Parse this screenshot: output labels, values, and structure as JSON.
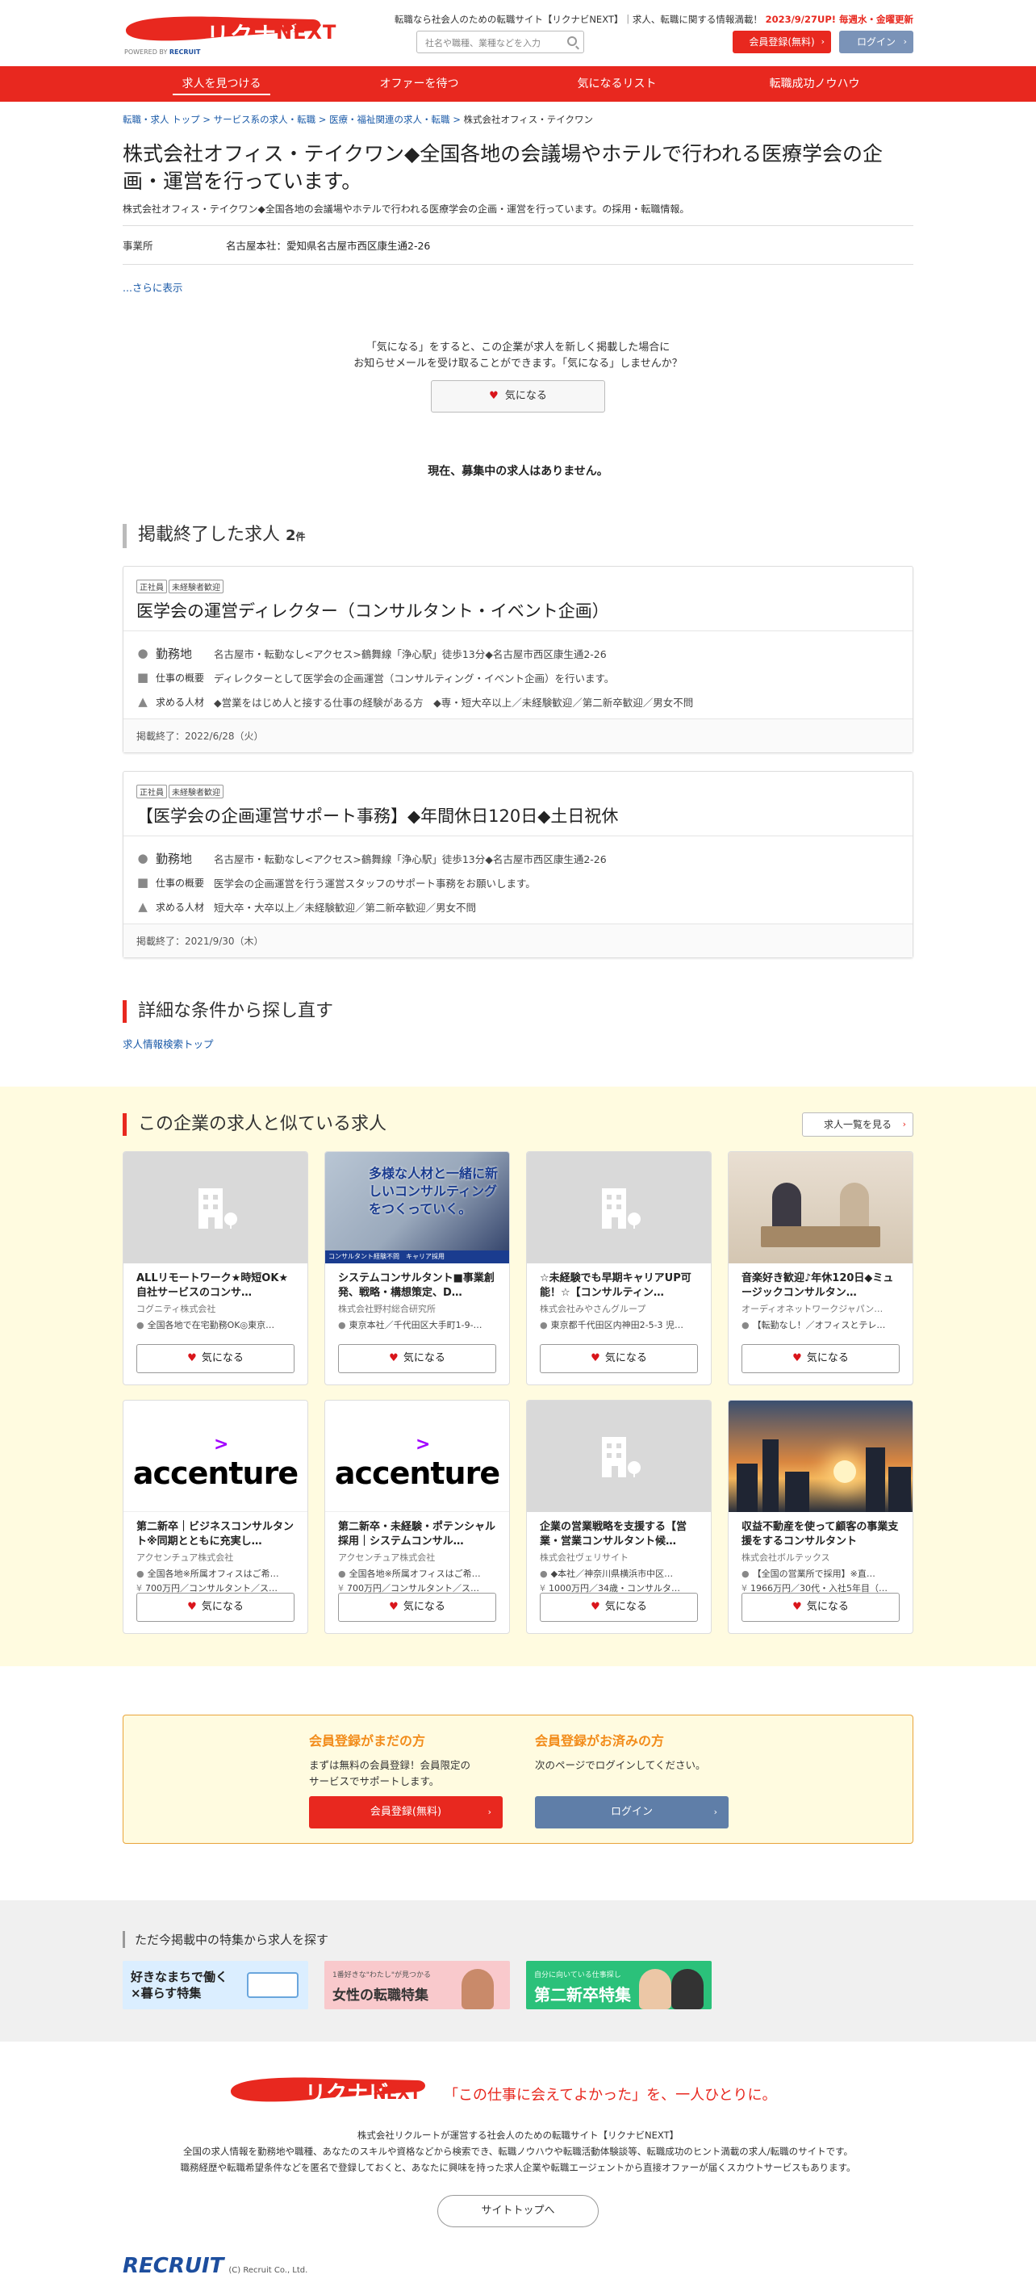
{
  "header": {
    "logo_text": "リクナビ",
    "logo_next": "NEXT",
    "powered_by": "POWERED BY",
    "powered_brand": "RECRUIT",
    "notice": "転職なら社会人のための転職サイト【リクナビNEXT】｜求人、転職に関する情報満載！",
    "notice_highlight": "2023/9/27UP! 毎週水・金曜更新",
    "search_placeholder": "社名や職種、業種などを入力",
    "register_label": "会員登録(無料)",
    "login_label": "ログイン"
  },
  "nav": [
    "求人を見つける",
    "オファーを待つ",
    "気になるリスト",
    "転職成功ノウハウ"
  ],
  "breadcrumb": {
    "items": [
      "転職・求人 トップ",
      "サービス系の求人・転職",
      "医療・福祉関連の求人・転職"
    ],
    "current": "株式会社オフィス・テイクワン"
  },
  "company": {
    "title": "株式会社オフィス・テイクワン◆全国各地の会議場やホテルで行われる医療学会の企画・運営を行っています。",
    "lead": "株式会社オフィス・テイクワン◆全国各地の会議場やホテルで行われる医療学会の企画・運営を行っています。の採用・転職情報。",
    "office_label": "事業所",
    "office_value": "名古屋本社：愛知県名古屋市西区康生通2-26",
    "more": "...さらに表示"
  },
  "favorite": {
    "note1": "「気になる」をすると、この企業が求人を新しく掲載した場合に",
    "note2": "お知らせメールを受け取ることができます。「気になる」しませんか？",
    "button": "気になる"
  },
  "no_jobs": "現在、募集中の求人はありません。",
  "ended": {
    "heading": "掲載終了した求人",
    "count": "2",
    "unit": "件",
    "labels": {
      "location": "勤務地",
      "summary": "仕事の概要",
      "require": "求める人材"
    },
    "jobs": [
      {
        "tags": [
          "正社員",
          "未経験者歓迎"
        ],
        "title": "医学会の運営ディレクター（コンサルタント・イベント企画）",
        "location": "名古屋市・転勤なし<アクセス>鶴舞線「浄心駅」徒歩13分◆名古屋市西区康生通2-26",
        "summary": "ディレクターとして医学会の企画運営（コンサルティング・イベント企画）を行います。",
        "require": "◆営業をはじめ人と接する仕事の経験がある方　◆専・短大卒以上／未経験歓迎／第二新卒歓迎／男女不問",
        "end": "掲載終了：2022/6/28（火）"
      },
      {
        "tags": [
          "正社員",
          "未経験者歓迎"
        ],
        "title": "【医学会の企画運営サポート事務】◆年間休日120日◆土日祝休",
        "location": "名古屋市・転勤なし<アクセス>鶴舞線「浄心駅」徒歩13分◆名古屋市西区康生通2-26",
        "summary": "医学会の企画運営を行う運営スタッフのサポート事務をお願いします。",
        "require": "短大卒・大卒以上／未経験歓迎／第二新卒歓迎／男女不問",
        "end": "掲載終了：2021/9/30（木）"
      }
    ]
  },
  "detail_search": {
    "heading": "詳細な条件から探し直す",
    "link": "求人情報検索トップ"
  },
  "similar": {
    "heading": "この企業の求人と似ている求人",
    "list_button": "求人一覧を見る",
    "fav_label": "気になる",
    "thumb1_text": "多様な人材と一緒に新しいコンサルティングをつくっていく。",
    "thumb1_bar": "コンサルタント経験不問　キャリア採用",
    "accenture": "accenture",
    "cards": [
      {
        "title": "ALLリモートワーク★時短OK★自社サービスのコンサ…",
        "company": "コグニティ株式会社",
        "line1": "全国各地で在宅勤務OK◎東京…"
      },
      {
        "title": "システムコンサルタント■事業創発、戦略・構想策定、D…",
        "company": "株式会社野村総合研究所",
        "line1": "東京本社／千代田区大手町1-9-…"
      },
      {
        "title": "☆未経験でも早期キャリアUP可能！☆【コンサルティン…",
        "company": "株式会社みやさんグループ",
        "line1": "東京都千代田区内神田2-5-3 児…"
      },
      {
        "title": "音楽好き歓迎♪年休120日◆ミュージックコンサルタン…",
        "company": "オーディオネットワークジャパン…",
        "line1": "【転勤なし！／オフィスとテレ…"
      },
      {
        "title": "第二新卒｜ビジネスコンサルタント※同期とともに充実し…",
        "company": "アクセンチュア株式会社",
        "line1": "全国各地※所属オフィスはご希…",
        "line2": "700万円／コンサルタント／ス…"
      },
      {
        "title": "第二新卒・未経験・ポテンシャル採用｜システムコンサル…",
        "company": "アクセンチュア株式会社",
        "line1": "全国各地※所属オフィスはご希…",
        "line2": "700万円／コンサルタント／ス…"
      },
      {
        "title": "企業の営業戦略を支援する【営業・営業コンサルタント候…",
        "company": "株式会社ヴェリサイト",
        "line1": "◆本社／神奈川県横浜市中区…",
        "line2": "1000万円／34歳・コンサルタ…"
      },
      {
        "title": "収益不動産を使って顧客の事業支援をするコンサルタント",
        "company": "株式会社ボルテックス",
        "line1": "【全国の営業所で採用】※直…",
        "line2": "1966万円／30代・入社5年目（…"
      }
    ]
  },
  "member": {
    "new_heading": "会員登録がまだの方",
    "new_text1": "まずは無料の会員登録！会員限定の",
    "new_text2": "サービスでサポートします。",
    "new_button": "会員登録(無料)",
    "ex_heading": "会員登録がお済みの方",
    "ex_text": "次のページでログインしてください。",
    "ex_button": "ログイン"
  },
  "feature": {
    "heading": "ただ今掲載中の特集から求人を探す",
    "b1": "好きなまちで働く×暮らす特集",
    "b2_sub": "1番好きな\"わたし\"が見つかる",
    "b2": "女性の転職特集",
    "b3_sub": "自分に向いている仕事探し",
    "b3": "第二新卒特集"
  },
  "footer": {
    "tagline": "「この仕事に会えてよかった」を、一人ひとりに。",
    "line1": "株式会社リクルートが運営する社会人のための転職サイト【リクナビNEXT】",
    "line2": "全国の求人情報を勤務地や職種、あなたのスキルや資格などから検索でき、転職ノウハウや転職活動体験談等、転職成功のヒント満載の求人/転職のサイトです。",
    "line3": "職務経歴や転職希望条件などを匿名で登録しておくと、あなたに興味を持った求人企業や転職エージェントから直接オファーが届くスカウトサービスもあります。",
    "site_top": "サイトトップへ",
    "recruit": "RECRUIT",
    "copyright": "(C) Recruit Co., Ltd."
  },
  "colors": {
    "brand_red": "#e8281f",
    "login_blue": "#7a93b8",
    "link_blue": "#1a5aa8",
    "orange": "#f28c1b"
  }
}
